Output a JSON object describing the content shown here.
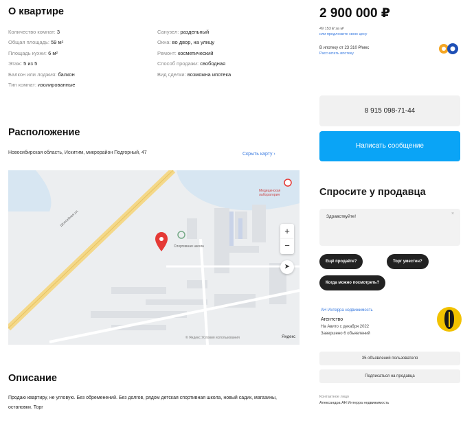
{
  "about": {
    "title": "О квартире",
    "params_left": [
      {
        "key": "Количество комнат:",
        "value": "3"
      },
      {
        "key": "Общая площадь:",
        "value": "59 м²"
      },
      {
        "key": "Площадь кухни:",
        "value": "6 м²"
      },
      {
        "key": "Этаж:",
        "value": "5 из 5"
      },
      {
        "key": "Балкон или лоджия:",
        "value": "балкон"
      },
      {
        "key": "Тип комнат:",
        "value": "изолированные"
      }
    ],
    "params_right": [
      {
        "key": "Санузел:",
        "value": "раздельный"
      },
      {
        "key": "Окна:",
        "value": "во двор, на улицу"
      },
      {
        "key": "Ремонт:",
        "value": "косметический"
      },
      {
        "key": "Способ продажи:",
        "value": "свободная"
      },
      {
        "key": "Вид сделки:",
        "value": "возможна ипотека"
      }
    ]
  },
  "location": {
    "title": "Расположение",
    "address": "Новосибирская область, Искитим, микрорайон Подгорный, 47",
    "hide_map": "Скрыть карту ›",
    "map_street": "Шоссейная ул.",
    "map_poi_school": "Спортивная школа",
    "map_poi_hospital": "Медицинская лаборатория",
    "map_zoom_in": "+",
    "map_zoom_out": "−",
    "map_locate": "➤",
    "map_copyright": "© Яндекс Условия использования",
    "map_brand": "Яндекс"
  },
  "description": {
    "title": "Описание",
    "text": "Продаю квартиру, не угловую. Без обременений. Без долгов, рядом детская спортивная школа, новый садик, магазины, остановки. Торг"
  },
  "sidebar": {
    "price": "2 900 000 ₽",
    "price_per_m": "49 153 ₽ за м²",
    "offer_price": "или предложите свою цену",
    "mortgage": "В ипотеку от 23 310 ₽/мес",
    "mortgage_link": "Рассчитать ипотеку",
    "phone": "8 915 098-71-44",
    "write_message": "Написать сообщение",
    "ask_title": "Спросите у продавца",
    "ask_placeholder": "Здравствуйте!",
    "ask_clear": "×",
    "chips": [
      "Ещё продаёте?",
      "Торг уместен?",
      "Когда можно посмотреть?"
    ],
    "seller_name": "АН Интерра недвижимость",
    "seller_type": "Агентство",
    "seller_since": "На Авито с декабря 2022",
    "seller_done": "Завершено 6 объявлений",
    "seller_ads": "35 объявлений пользователя",
    "subscribe": "Подписаться на продавца",
    "contact_label": "Контактное лицо",
    "contact_name": "Александра АН Интерра недвижимость"
  },
  "colors": {
    "accent_blue": "#0aa4f6",
    "link_blue": "#3a7be0",
    "map_pin": "#e53935"
  }
}
